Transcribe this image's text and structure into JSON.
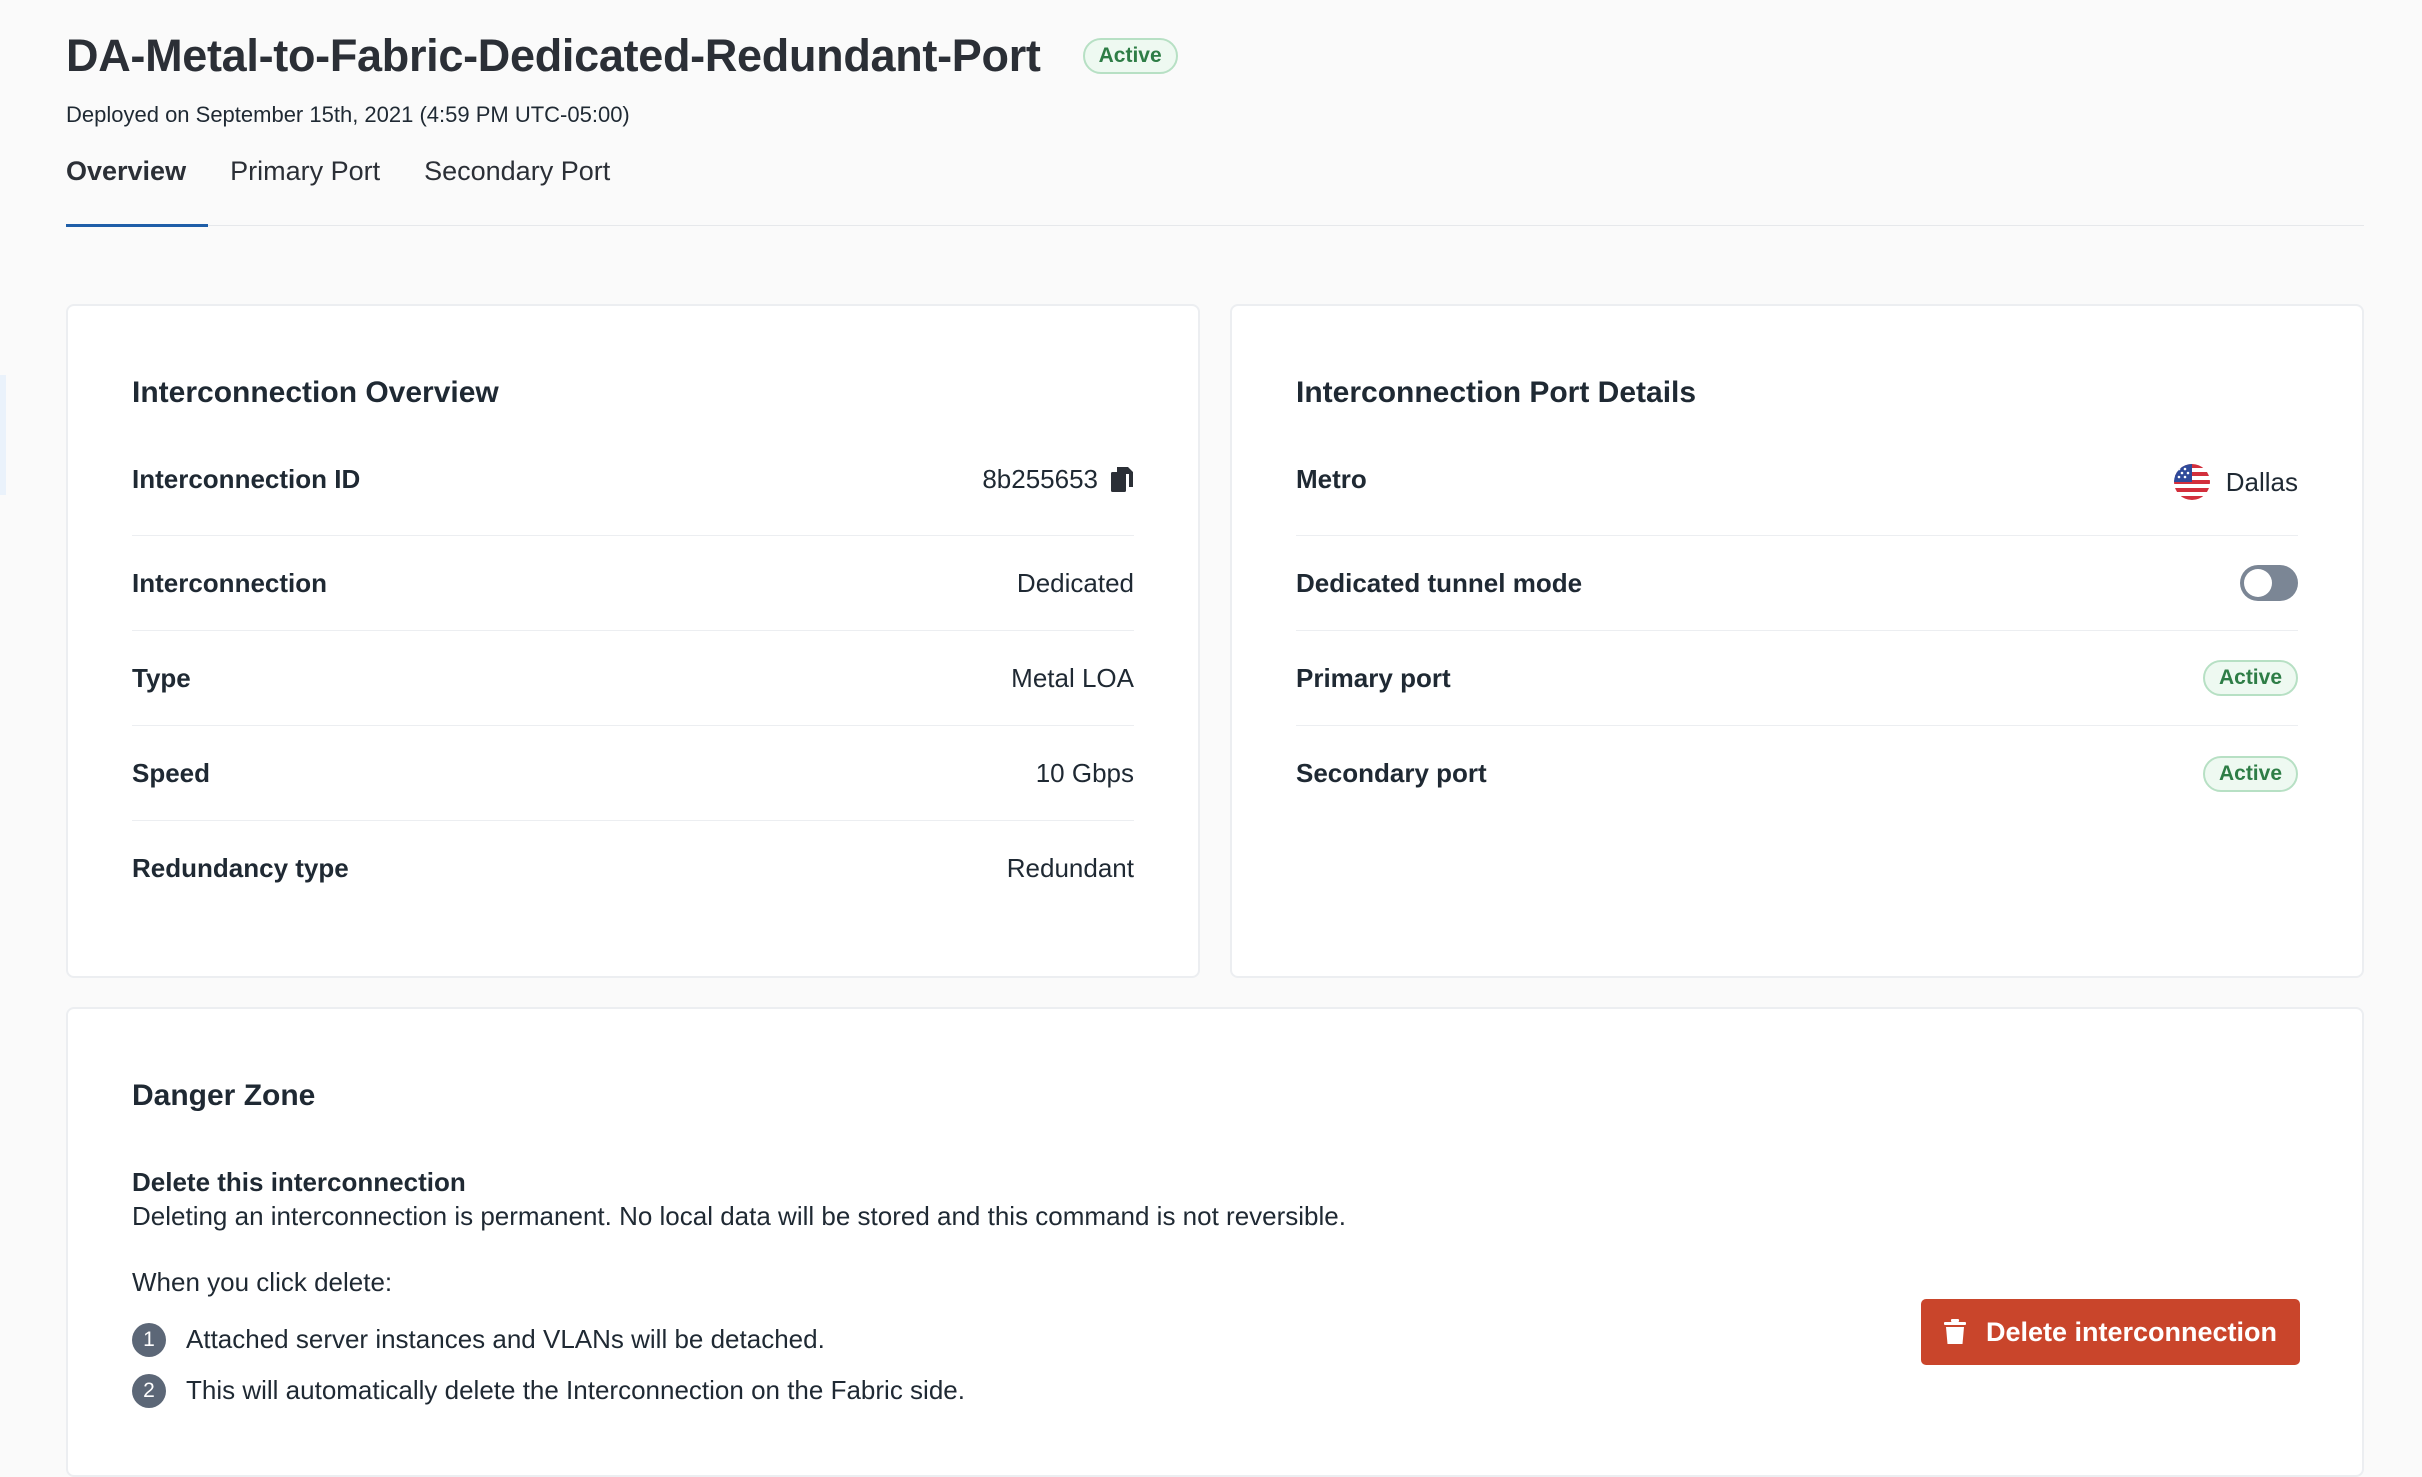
{
  "header": {
    "title": "DA-Metal-to-Fabric-Dedicated-Redundant-Port",
    "status": "Active",
    "deployed": "Deployed on September 15th, 2021 (4:59 PM UTC-05:00)"
  },
  "tabs": [
    {
      "label": "Overview",
      "active": true
    },
    {
      "label": "Primary Port",
      "active": false
    },
    {
      "label": "Secondary Port",
      "active": false
    }
  ],
  "overview": {
    "title": "Interconnection Overview",
    "rows": [
      {
        "label": "Interconnection ID",
        "value": "8b255653"
      },
      {
        "label": "Interconnection",
        "value": "Dedicated"
      },
      {
        "label": "Type",
        "value": "Metal LOA"
      },
      {
        "label": "Speed",
        "value": "10 Gbps"
      },
      {
        "label": "Redundancy type",
        "value": "Redundant"
      }
    ]
  },
  "ports": {
    "title": "Interconnection Port Details",
    "metro_label": "Metro",
    "metro_value": "Dallas",
    "tunnel_label": "Dedicated tunnel mode",
    "tunnel_enabled": false,
    "primary_label": "Primary port",
    "primary_status": "Active",
    "secondary_label": "Secondary port",
    "secondary_status": "Active"
  },
  "danger": {
    "title": "Danger Zone",
    "subtitle": "Delete this interconnection",
    "description": "Deleting an interconnection is permanent. No local data will be stored and this command is not reversible.",
    "when": "When you click delete:",
    "steps": [
      {
        "num": "1",
        "text": "Attached server instances and VLANs will be detached."
      },
      {
        "num": "2",
        "text": "This will automatically delete the Interconnection on the Fabric side."
      }
    ],
    "button_label": "Delete interconnection"
  },
  "icons": {
    "copy": "copy-icon",
    "flag": "us-flag-icon",
    "trash": "trash-icon"
  },
  "colors": {
    "accent": "#1f5ea8",
    "danger": "#c9452b",
    "success": "#2e7d46"
  }
}
